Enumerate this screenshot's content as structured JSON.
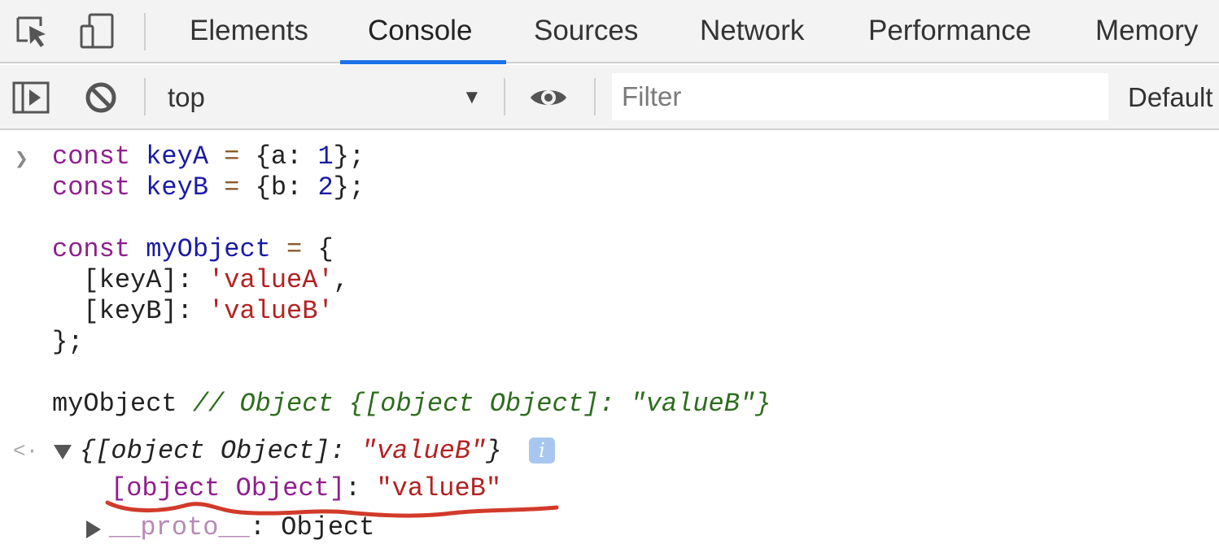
{
  "tabs": [
    {
      "label": "Elements"
    },
    {
      "label": "Console"
    },
    {
      "label": "Sources"
    },
    {
      "label": "Network"
    },
    {
      "label": "Performance"
    },
    {
      "label": "Memory"
    }
  ],
  "active_tab": "Console",
  "accent_color": "#1a73e8",
  "toolbar": {
    "context": "top",
    "filter_placeholder": "Filter",
    "levels": "Default"
  },
  "code": {
    "kw_const": "const",
    "keyA": "keyA",
    "keyB": "keyB",
    "myObject": "myObject",
    "eq": "=",
    "objA": "{a: ",
    "numA": "1",
    "closeA": "};",
    "objB": "{b: ",
    "numB": "2",
    "closeB": "};",
    "open_brace": "{",
    "bracket_keyA": "  [keyA]: ",
    "valueA": "'valueA'",
    "comma": ",",
    "bracket_keyB": "  [keyB]: ",
    "valueB": "'valueB'",
    "close_obj": "};",
    "expr": "myObject ",
    "comment": "// Object {[object Object]: \"valueB\"}"
  },
  "result": {
    "preview_open": "{[object Object]: ",
    "preview_value": "\"valueB\"",
    "preview_close": "}",
    "info": "i",
    "prop_key": "[object Object]",
    "prop_sep": ": ",
    "prop_value": "\"valueB\"",
    "proto_key": "__proto__",
    "proto_sep": ": ",
    "proto_value": "Object"
  },
  "annotation_color": "#d23a2a"
}
